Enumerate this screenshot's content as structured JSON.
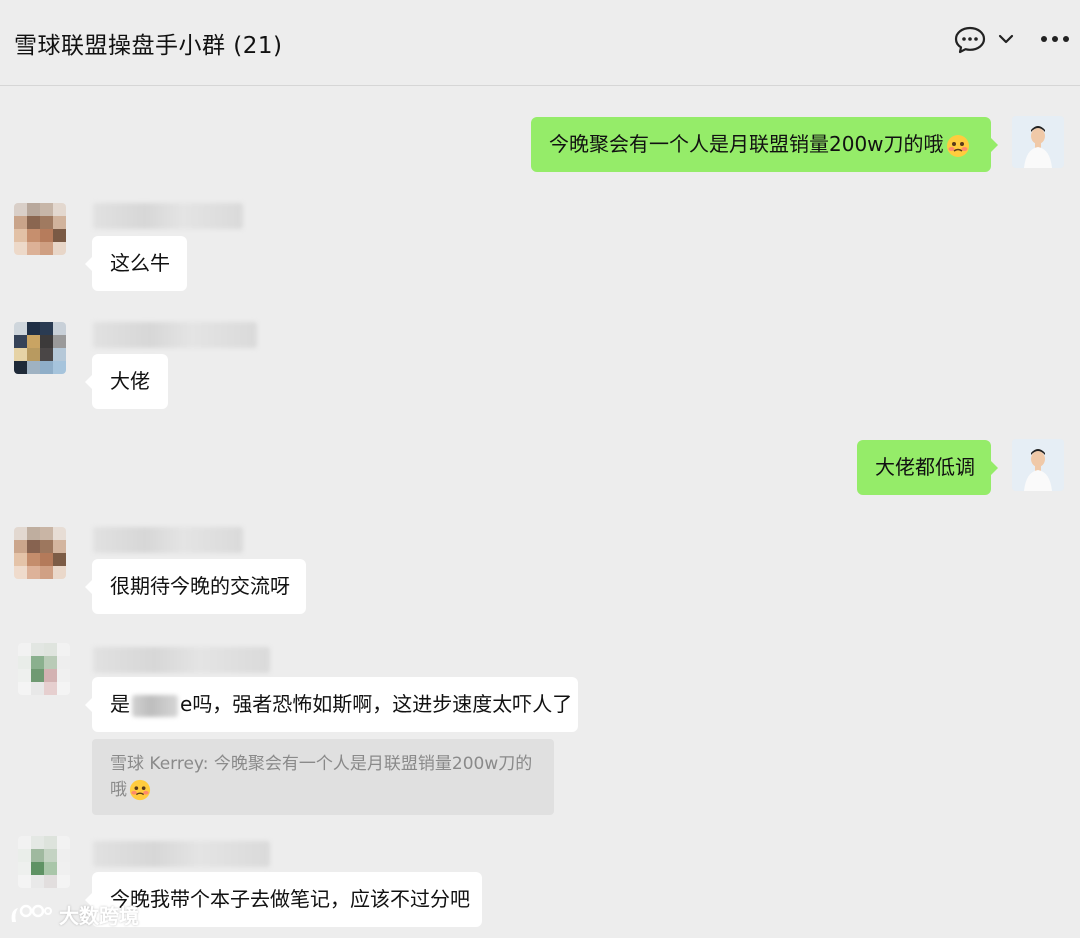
{
  "header": {
    "title": "雪球联盟操盘手小群 (21)",
    "icons": [
      "chat-bubble-icon",
      "chevron-down-icon",
      "more-icon"
    ]
  },
  "messages": [
    {
      "side": "out",
      "text": "今晚聚会有一个人是月联盟销量200w刀的哦",
      "emoji": "hot-face-emoji"
    },
    {
      "side": "in",
      "text": "这么牛"
    },
    {
      "side": "in",
      "text": "大佬"
    },
    {
      "side": "out",
      "text": "大佬都低调"
    },
    {
      "side": "in",
      "text": "很期待今晚的交流呀"
    },
    {
      "side": "in",
      "text_before": "是",
      "text_redacted_tail": "e",
      "text_after": "吗，强者恐怖如斯啊，这进步速度太吓人了",
      "quote": {
        "line1": "雪球 Kerrey: 今晚聚会有一个人是月联盟销量200w刀的",
        "line2": "哦"
      }
    },
    {
      "side": "in",
      "text": "今晚我带个本子去做笔记，应该不过分吧"
    }
  ],
  "watermark": {
    "text": "大数跨境"
  },
  "colors": {
    "background": "#ededed",
    "incoming_bubble": "#ffffff",
    "outgoing_bubble": "#95ec69",
    "quote_background": "#e0e0e0"
  }
}
